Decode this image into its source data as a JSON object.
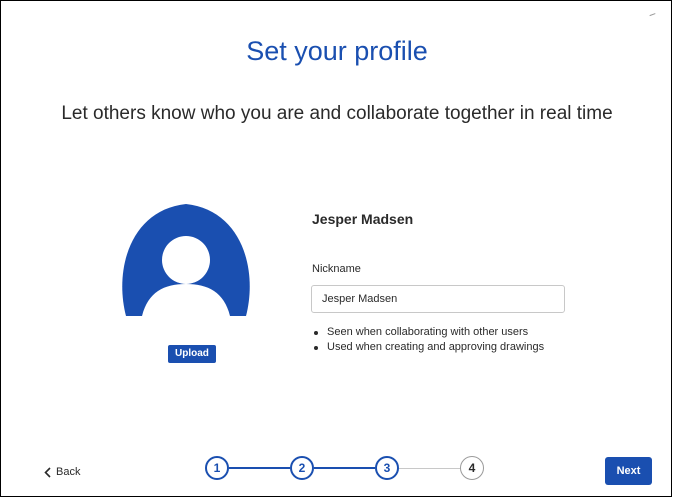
{
  "header": {
    "title": "Set your profile",
    "subtitle": "Let others know who you are and collaborate together in real time"
  },
  "profile": {
    "avatar_icon": "user-avatar-icon",
    "upload_label": "Upload",
    "user_name": "Jesper Madsen",
    "nickname_label": "Nickname",
    "nickname_value": "Jesper Madsen",
    "hints": [
      "Seen when collaborating with other users",
      "Used when creating and approving drawings"
    ]
  },
  "footer": {
    "back_label": "Back",
    "next_label": "Next",
    "steps": [
      "1",
      "2",
      "3",
      "4"
    ],
    "current_step": 3
  },
  "colors": {
    "accent": "#1a4fb0",
    "text": "#2a2a2a"
  }
}
